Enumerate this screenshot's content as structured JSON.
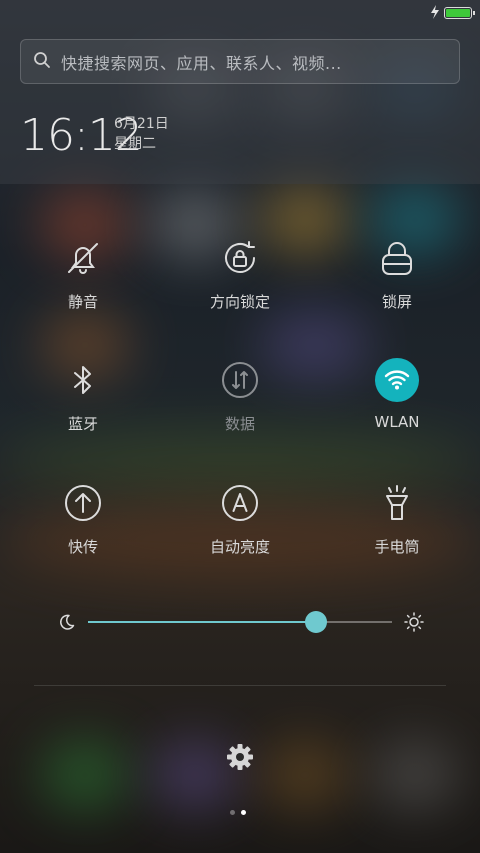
{
  "status": {
    "battery_level": 1.0,
    "charging": true
  },
  "search": {
    "placeholder": "快捷搜索网页、应用、联系人、视频..."
  },
  "clock": {
    "time": "16:12",
    "date": "6月21日",
    "weekday": "星期二"
  },
  "toggles": [
    {
      "label": "静音",
      "icon": "bell-off-icon",
      "active": false
    },
    {
      "label": "方向锁定",
      "icon": "rotation-lock-icon",
      "active": false
    },
    {
      "label": "锁屏",
      "icon": "lock-icon",
      "active": false
    },
    {
      "label": "蓝牙",
      "icon": "bluetooth-icon",
      "active": false
    },
    {
      "label": "数据",
      "icon": "mobile-data-icon",
      "active": false,
      "disabled": true
    },
    {
      "label": "WLAN",
      "icon": "wifi-icon",
      "active": true
    },
    {
      "label": "快传",
      "icon": "share-upload-icon",
      "active": false
    },
    {
      "label": "自动亮度",
      "icon": "auto-brightness-icon",
      "active": false
    },
    {
      "label": "手电筒",
      "icon": "flashlight-icon",
      "active": false
    }
  ],
  "brightness": {
    "level": 0.75
  },
  "pager": {
    "pages": 2,
    "current": 2
  },
  "colors": {
    "accent": "#14b3bd",
    "slider": "#6fc9cf",
    "battery": "#3ec93a"
  }
}
